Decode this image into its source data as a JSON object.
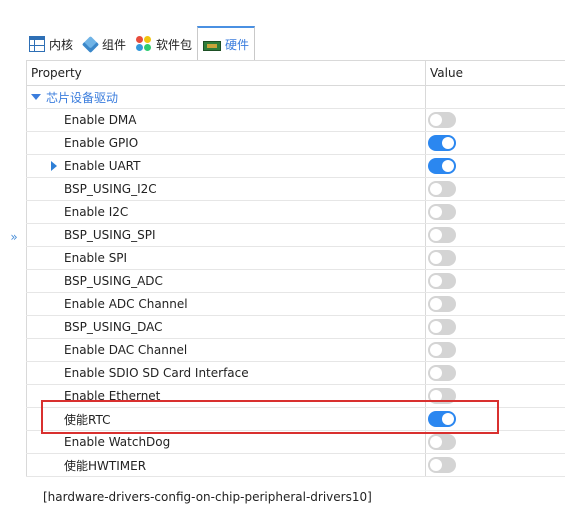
{
  "tabs": [
    {
      "label": "内核",
      "icon": "table-icon",
      "active": false
    },
    {
      "label": "组件",
      "icon": "cube-icon",
      "active": false
    },
    {
      "label": "软件包",
      "icon": "packages-icon",
      "active": false
    },
    {
      "label": "硬件",
      "icon": "board-icon",
      "active": true
    }
  ],
  "grid": {
    "header_property": "Property",
    "header_value": "Value",
    "category_label": "芯片设备驱动",
    "rows": [
      {
        "label": "Enable DMA",
        "on": false
      },
      {
        "label": "Enable GPIO",
        "on": true
      },
      {
        "label": "Enable UART",
        "on": true,
        "expandable": true
      },
      {
        "label": "BSP_USING_I2C",
        "on": false
      },
      {
        "label": "Enable I2C",
        "on": false
      },
      {
        "label": "BSP_USING_SPI",
        "on": false
      },
      {
        "label": "Enable SPI",
        "on": false
      },
      {
        "label": "BSP_USING_ADC",
        "on": false
      },
      {
        "label": "Enable ADC Channel",
        "on": false
      },
      {
        "label": "BSP_USING_DAC",
        "on": false
      },
      {
        "label": "Enable DAC Channel",
        "on": false
      },
      {
        "label": "Enable SDIO SD Card Interface",
        "on": false
      },
      {
        "label": "Enable Ethernet",
        "on": false
      },
      {
        "label": "使能RTC",
        "on": true
      },
      {
        "label": "Enable WatchDog",
        "on": false
      },
      {
        "label": "使能HWTIMER",
        "on": false
      }
    ]
  },
  "side_button": "»",
  "footer": "[hardware-drivers-config-on-chip-peripheral-drivers10]",
  "colors": {
    "accent": "#2b87f0",
    "highlight": "#d9302f",
    "category": "#3b7ddd"
  }
}
